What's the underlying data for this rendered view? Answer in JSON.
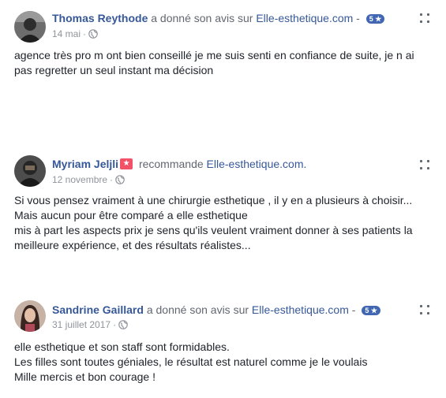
{
  "reviews": [
    {
      "author": "Thomas Reythode",
      "action": "a donné son avis sur",
      "page": "Elle-esthetique.com",
      "separator": " - ",
      "rating": "5 ★",
      "date": "14 mai",
      "meta_separator": "·",
      "lines": [
        "agence très pro m ont bien conseillé je me suis senti en confiance de suite, je n ai",
        "pas regretter un seul instant ma décision"
      ]
    },
    {
      "author": "Myriam Jeljli",
      "action": "recommande",
      "page": "Elle-esthetique.com.",
      "recommend_icon": "★",
      "date": "12 novembre",
      "meta_separator": "·",
      "lines": [
        "Si vous pensez vraiment à une chirurgie esthetique , il y en a plusieurs à choisir...",
        "Mais aucun pour être comparé a elle esthetique",
        "mis à part les aspects prix je sens qu'ils veulent vraiment donner à ses patients la",
        "meilleure expérience, et des résultats réalistes..."
      ]
    },
    {
      "author": "Sandrine Gaillard",
      "action": "a donné son avis sur",
      "page": "Elle-esthetique.com",
      "separator": " - ",
      "rating": "5 ★",
      "date": "31 juillet 2017",
      "meta_separator": "·",
      "lines": [
        "elle esthetique et son staff sont formidables.",
        "Les filles sont toutes géniales, le résultat est naturel comme je le voulais",
        "Mille mercis et bon courage !"
      ]
    }
  ],
  "colors": {
    "link": "#365899",
    "secondary_text": "#90949c",
    "rating_badge": "#4267b2",
    "recommend_badge": "#f25268"
  },
  "icons": {
    "privacy": "globe-icon",
    "options": "more-options-icon",
    "recommend": "recommend-star-icon"
  }
}
